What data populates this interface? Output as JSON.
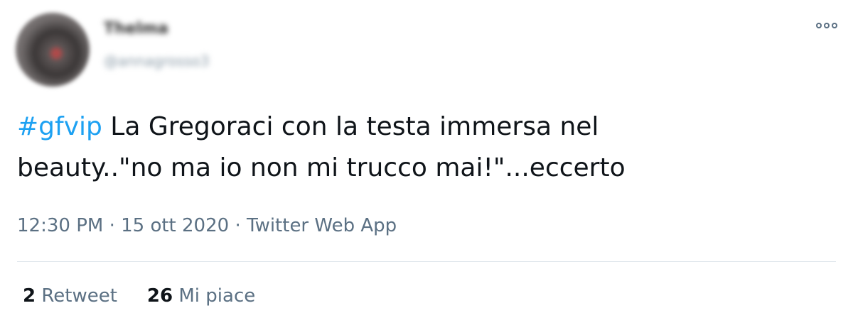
{
  "user": {
    "display_name": "Thelma",
    "handle": "@annagrosso3"
  },
  "tweet": {
    "hashtag": "#gfvip",
    "text_line1": " La Gregoraci con la testa immersa nel",
    "text_line2": "beauty..\"no ma io non mi trucco mai!\"...eccerto"
  },
  "meta": {
    "time": "12:30 PM",
    "date": "15 ott 2020",
    "separator": " · ",
    "source": "Twitter Web App"
  },
  "stats": {
    "retweets_count": "2",
    "retweets_label": "Retweet",
    "likes_count": "26",
    "likes_label": "Mi piace"
  },
  "colors": {
    "link": "#1da1f2",
    "text": "#0f1419",
    "secondary": "#5b7083",
    "divider": "#e1e8ed"
  },
  "icons": {
    "more": "more-options-icon"
  }
}
